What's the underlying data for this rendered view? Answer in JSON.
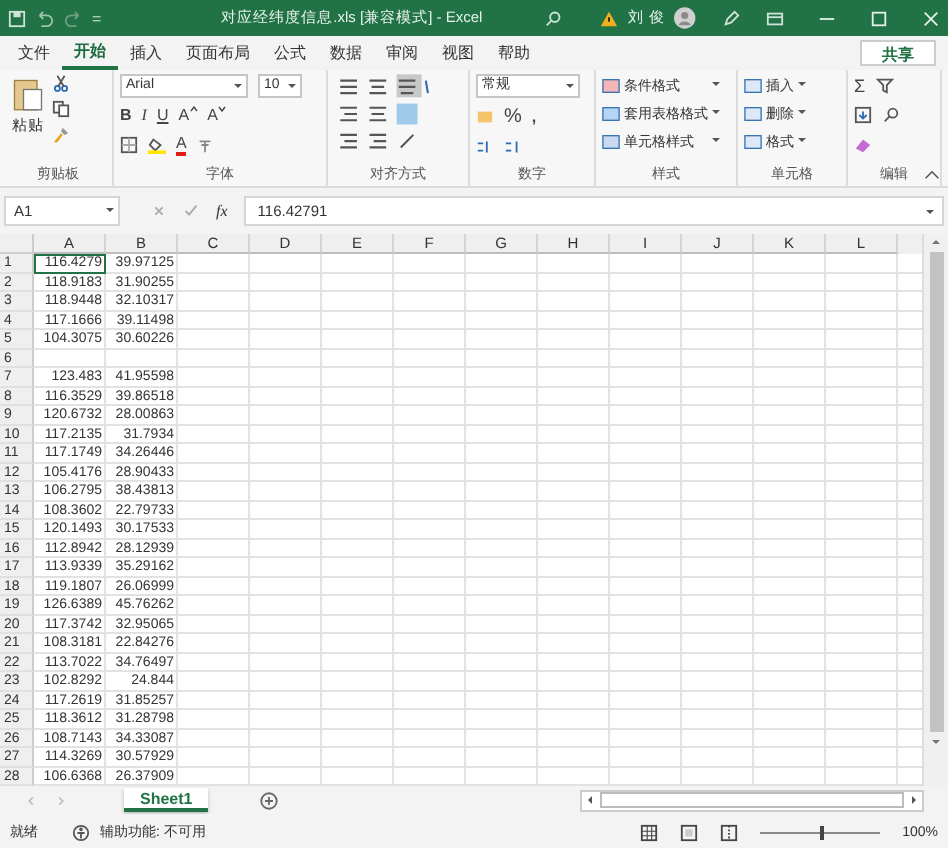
{
  "title_bar": {
    "title": "对应经纬度信息.xls  [兼容模式]  -  Excel",
    "quick_access": "=",
    "user": "刘 俊"
  },
  "tabs": [
    {
      "label": "文件",
      "selected": false
    },
    {
      "label": "开始",
      "selected": true
    },
    {
      "label": "插入",
      "selected": false
    },
    {
      "label": "页面布局",
      "selected": false
    },
    {
      "label": "公式",
      "selected": false
    },
    {
      "label": "数据",
      "selected": false
    },
    {
      "label": "审阅",
      "selected": false
    },
    {
      "label": "视图",
      "selected": false
    },
    {
      "label": "帮助",
      "selected": false
    }
  ],
  "share": "共享",
  "ribbon": {
    "groups": [
      {
        "kind": "clipboard",
        "label": "剪贴板",
        "paste": "粘贴"
      },
      {
        "kind": "font",
        "label": "字体",
        "font_name": "Arial",
        "font_size": "10",
        "styles": [
          "B",
          "I",
          "U"
        ],
        "grow": "A",
        "shrink": "A",
        "font_color": "A"
      },
      {
        "kind": "align",
        "label": "对齐方式"
      },
      {
        "kind": "number",
        "label": "数字",
        "format": "常规",
        "percent": "%",
        "comma": ","
      },
      {
        "kind": "styles",
        "label": "样式",
        "items": [
          "条件格式",
          "套用表格格式",
          "单元格样式"
        ]
      },
      {
        "kind": "cells",
        "label": "单元格",
        "items": [
          "插入",
          "删除",
          "格式"
        ]
      },
      {
        "kind": "edit",
        "label": "编辑",
        "sum": "Σ"
      }
    ]
  },
  "formula_bar": {
    "name_box": "A1",
    "fx": "fx",
    "value": "116.42791"
  },
  "columns": [
    "A",
    "B",
    "C",
    "D",
    "E",
    "F",
    "G",
    "H",
    "I",
    "J",
    "K",
    "L"
  ],
  "rows": [
    {
      "num": "1",
      "a": "116.4279",
      "b": "39.97125"
    },
    {
      "num": "2",
      "a": "118.9183",
      "b": "31.90255"
    },
    {
      "num": "3",
      "a": "118.9448",
      "b": "32.10317"
    },
    {
      "num": "4",
      "a": "117.1666",
      "b": "39.11498"
    },
    {
      "num": "5",
      "a": "104.3075",
      "b": "30.60226"
    },
    {
      "num": "6"
    },
    {
      "num": "7",
      "a": "123.483",
      "b": "41.95598"
    },
    {
      "num": "8",
      "a": "116.3529",
      "b": "39.86518"
    },
    {
      "num": "9",
      "a": "120.6732",
      "b": "28.00863"
    },
    {
      "num": "10",
      "a": "117.2135",
      "b": "31.7934"
    },
    {
      "num": "11",
      "a": "117.1749",
      "b": "34.26446"
    },
    {
      "num": "12",
      "a": "105.4176",
      "b": "28.90433"
    },
    {
      "num": "13",
      "a": "106.2795",
      "b": "38.43813"
    },
    {
      "num": "14",
      "a": "108.3602",
      "b": "22.79733"
    },
    {
      "num": "15",
      "a": "120.1493",
      "b": "30.17533"
    },
    {
      "num": "16",
      "a": "112.8942",
      "b": "28.12939"
    },
    {
      "num": "17",
      "a": "113.9339",
      "b": "35.29162"
    },
    {
      "num": "18",
      "a": "119.1807",
      "b": "26.06999"
    },
    {
      "num": "19",
      "a": "126.6389",
      "b": "45.76262"
    },
    {
      "num": "20",
      "a": "117.3742",
      "b": "32.95065"
    },
    {
      "num": "21",
      "a": "108.3181",
      "b": "22.84276"
    },
    {
      "num": "22",
      "a": "113.7022",
      "b": "34.76497"
    },
    {
      "num": "23",
      "a": "102.8292",
      "b": "24.844"
    },
    {
      "num": "24",
      "a": "117.2619",
      "b": "31.85257"
    },
    {
      "num": "25",
      "a": "118.3612",
      "b": "31.28798"
    },
    {
      "num": "26",
      "a": "108.7143",
      "b": "34.33087"
    },
    {
      "num": "27",
      "a": "114.3269",
      "b": "30.57929"
    },
    {
      "num": "28",
      "a": "106.6368",
      "b": "26.37909"
    }
  ],
  "sheets": [
    {
      "label": "Sheet1",
      "selected": true
    }
  ],
  "status_bar": {
    "ready": "就绪",
    "accessibility": "辅助功能: 不可用",
    "zoom": "100%",
    "zoom_slider": {
      "level": 0.5
    }
  }
}
